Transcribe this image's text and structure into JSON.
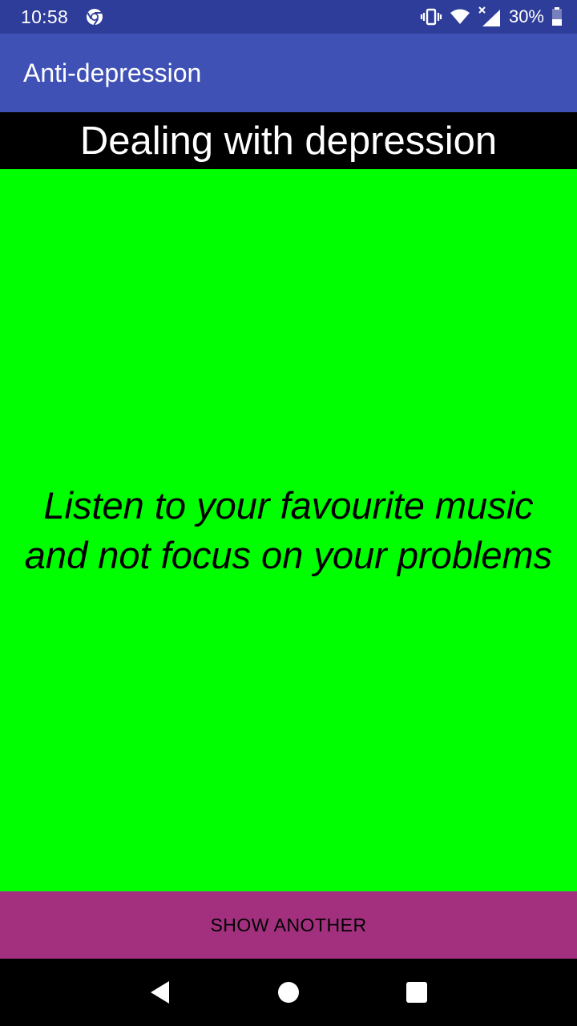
{
  "status_bar": {
    "time": "10:58",
    "battery_percent": "30%",
    "icons": [
      "chrome-icon",
      "vibrate-icon",
      "wifi-icon",
      "cell-signal-icon",
      "battery-icon"
    ]
  },
  "app_bar": {
    "title": "Anti-depression"
  },
  "headline": "Dealing with depression",
  "tip": {
    "text": "Listen to your favourite music and not focus on your problems",
    "background": "#00ff00"
  },
  "action": {
    "label": "SHOW ANOTHER",
    "background": "#a3307f"
  },
  "colors": {
    "status_bar": "#2e3d99",
    "app_bar": "#3f51b5"
  },
  "nav_bar": {
    "icons": [
      "back-icon",
      "home-icon",
      "recents-icon"
    ]
  }
}
